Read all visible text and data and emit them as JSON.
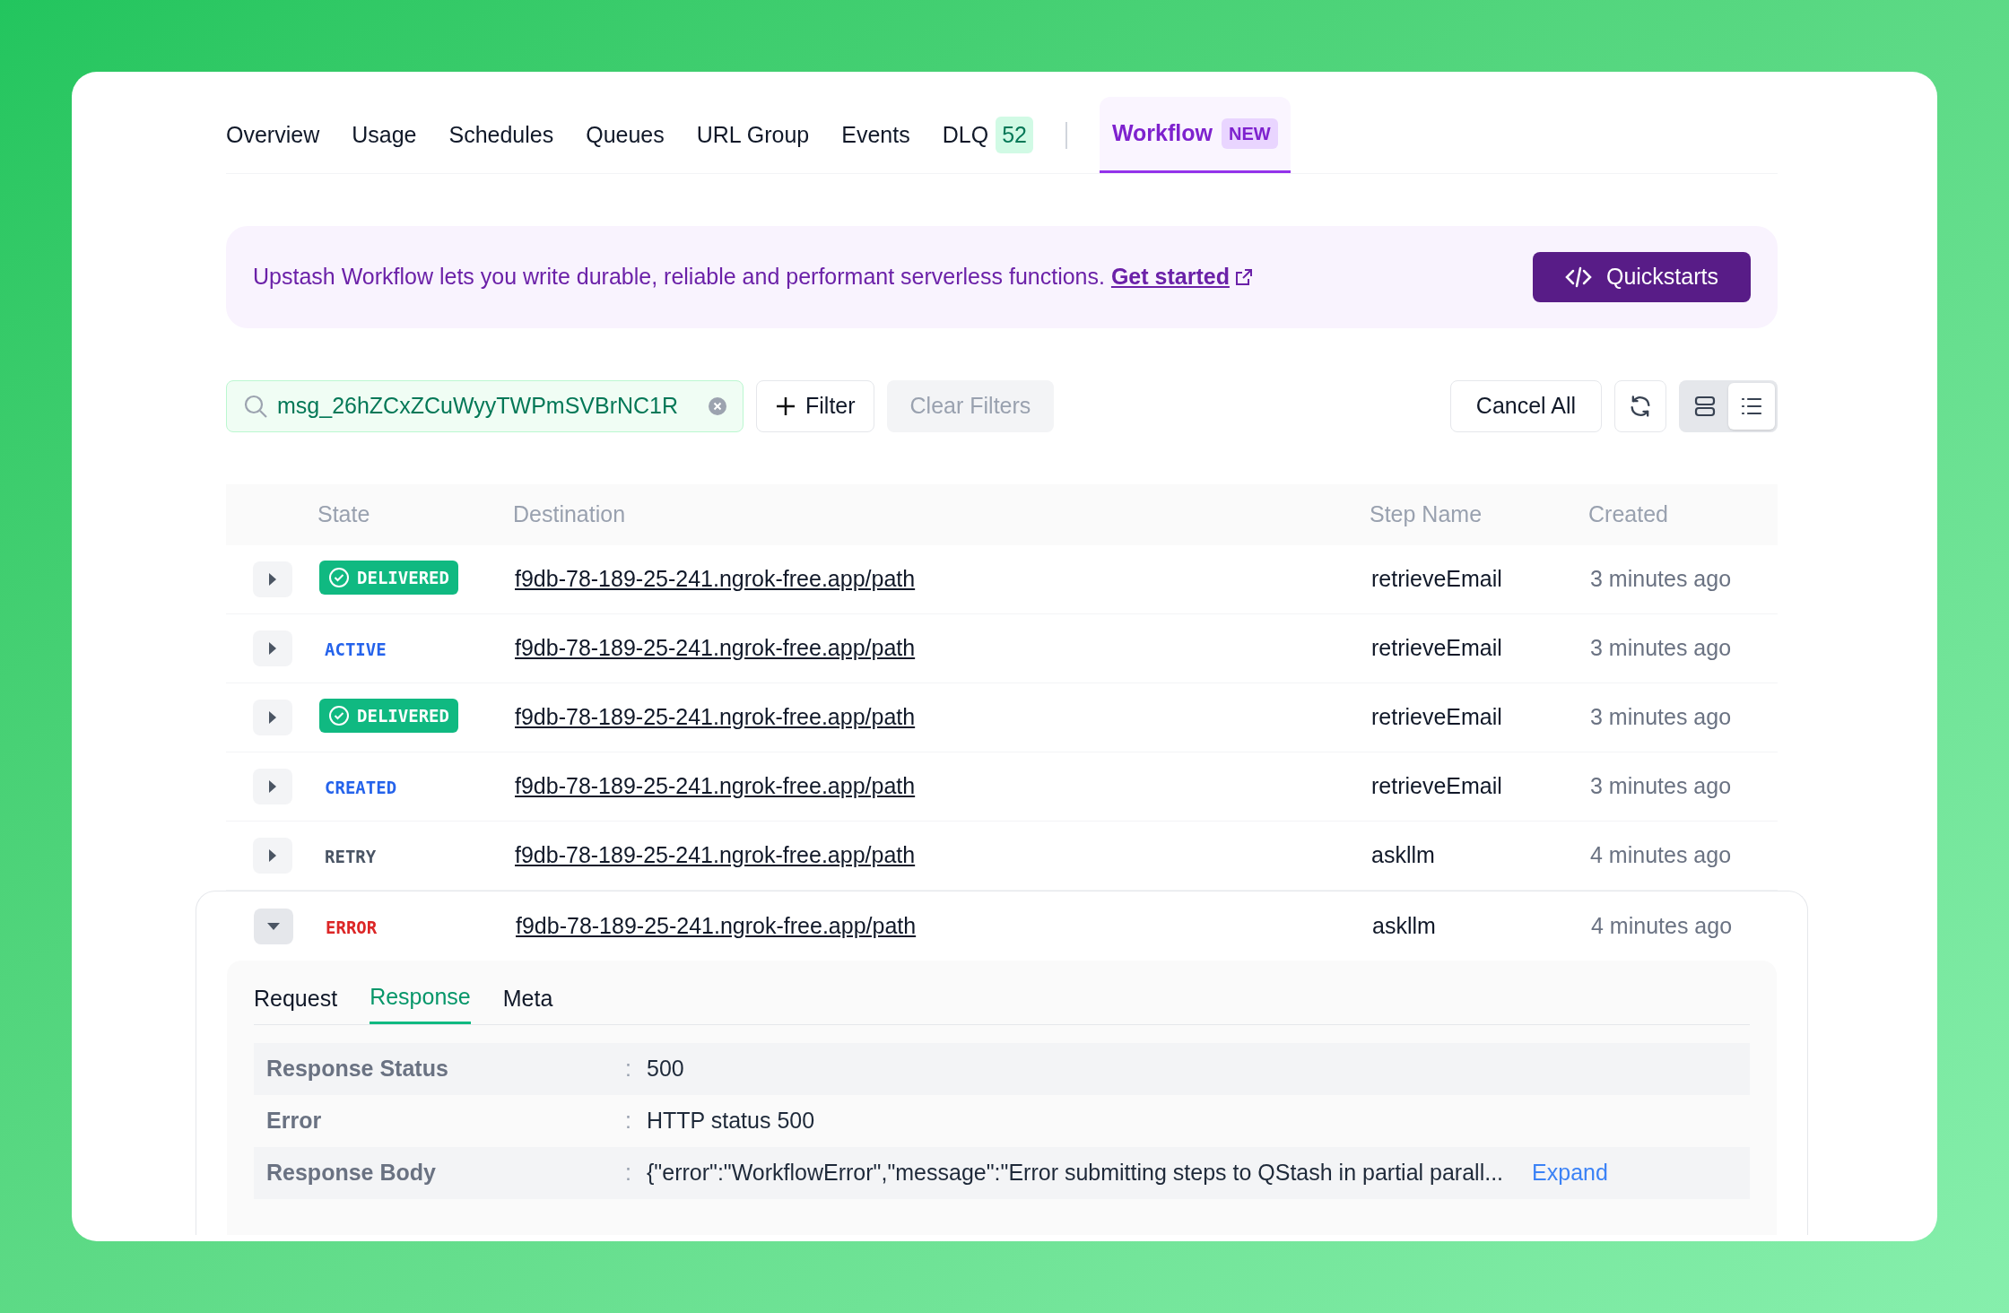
{
  "nav": {
    "tabs": [
      {
        "label": "Overview",
        "selected": false
      },
      {
        "label": "Usage",
        "selected": false
      },
      {
        "label": "Schedules",
        "selected": false
      },
      {
        "label": "Queues",
        "selected": false
      },
      {
        "label": "URL Group",
        "selected": false
      },
      {
        "label": "Events",
        "selected": false
      },
      {
        "label": "DLQ",
        "selected": false,
        "count": "52"
      },
      {
        "label": "Workflow",
        "selected": true,
        "badge": "NEW"
      }
    ]
  },
  "banner": {
    "text": "Upstash Workflow lets you write durable, reliable and performant serverless functions.",
    "link": "Get started",
    "button": "Quickstarts"
  },
  "toolbar": {
    "search": {
      "value": "msg_26hZCxZCuWyyTWPmSVBrNC1R"
    },
    "filter_button": "Filter",
    "clear_button": "Clear Filters",
    "cancel_button": "Cancel All",
    "views": [
      {
        "kind": "cards",
        "selected": false
      },
      {
        "kind": "list",
        "selected": true
      }
    ]
  },
  "table": {
    "columns": [
      "State",
      "Destination",
      "Step Name",
      "Created"
    ],
    "rows": [
      {
        "state": "DELIVERED",
        "kind": "delivered",
        "destination": "f9db-78-189-25-241.ngrok-free.app/path",
        "step": "retrieveEmail",
        "created": "3 minutes ago",
        "expanded": false
      },
      {
        "state": "ACTIVE",
        "kind": "active",
        "destination": "f9db-78-189-25-241.ngrok-free.app/path",
        "step": "retrieveEmail",
        "created": "3 minutes ago",
        "expanded": false
      },
      {
        "state": "DELIVERED",
        "kind": "delivered",
        "destination": "f9db-78-189-25-241.ngrok-free.app/path",
        "step": "retrieveEmail",
        "created": "3 minutes ago",
        "expanded": false
      },
      {
        "state": "CREATED",
        "kind": "created",
        "destination": "f9db-78-189-25-241.ngrok-free.app/path",
        "step": "retrieveEmail",
        "created": "3 minutes ago",
        "expanded": false
      },
      {
        "state": "RETRY",
        "kind": "retry",
        "destination": "f9db-78-189-25-241.ngrok-free.app/path",
        "step": "askllm",
        "created": "4 minutes ago",
        "expanded": false
      },
      {
        "state": "ERROR",
        "kind": "error",
        "destination": "f9db-78-189-25-241.ngrok-free.app/path",
        "step": "askllm",
        "created": "4 minutes ago",
        "expanded": true
      }
    ]
  },
  "details": {
    "tabs": [
      {
        "label": "Request",
        "selected": false
      },
      {
        "label": "Response",
        "selected": true
      },
      {
        "label": "Meta",
        "selected": false
      }
    ],
    "fields": [
      {
        "label": "Response Status",
        "separator": ":",
        "value": "500"
      },
      {
        "label": "Error",
        "separator": ":",
        "value": "HTTP status 500"
      },
      {
        "label": "Response Body",
        "separator": ":",
        "value": "{\"error\":\"WorkflowError\",\"message\":\"Error submitting steps to QStash in partial parall...",
        "action": "Expand"
      }
    ]
  }
}
